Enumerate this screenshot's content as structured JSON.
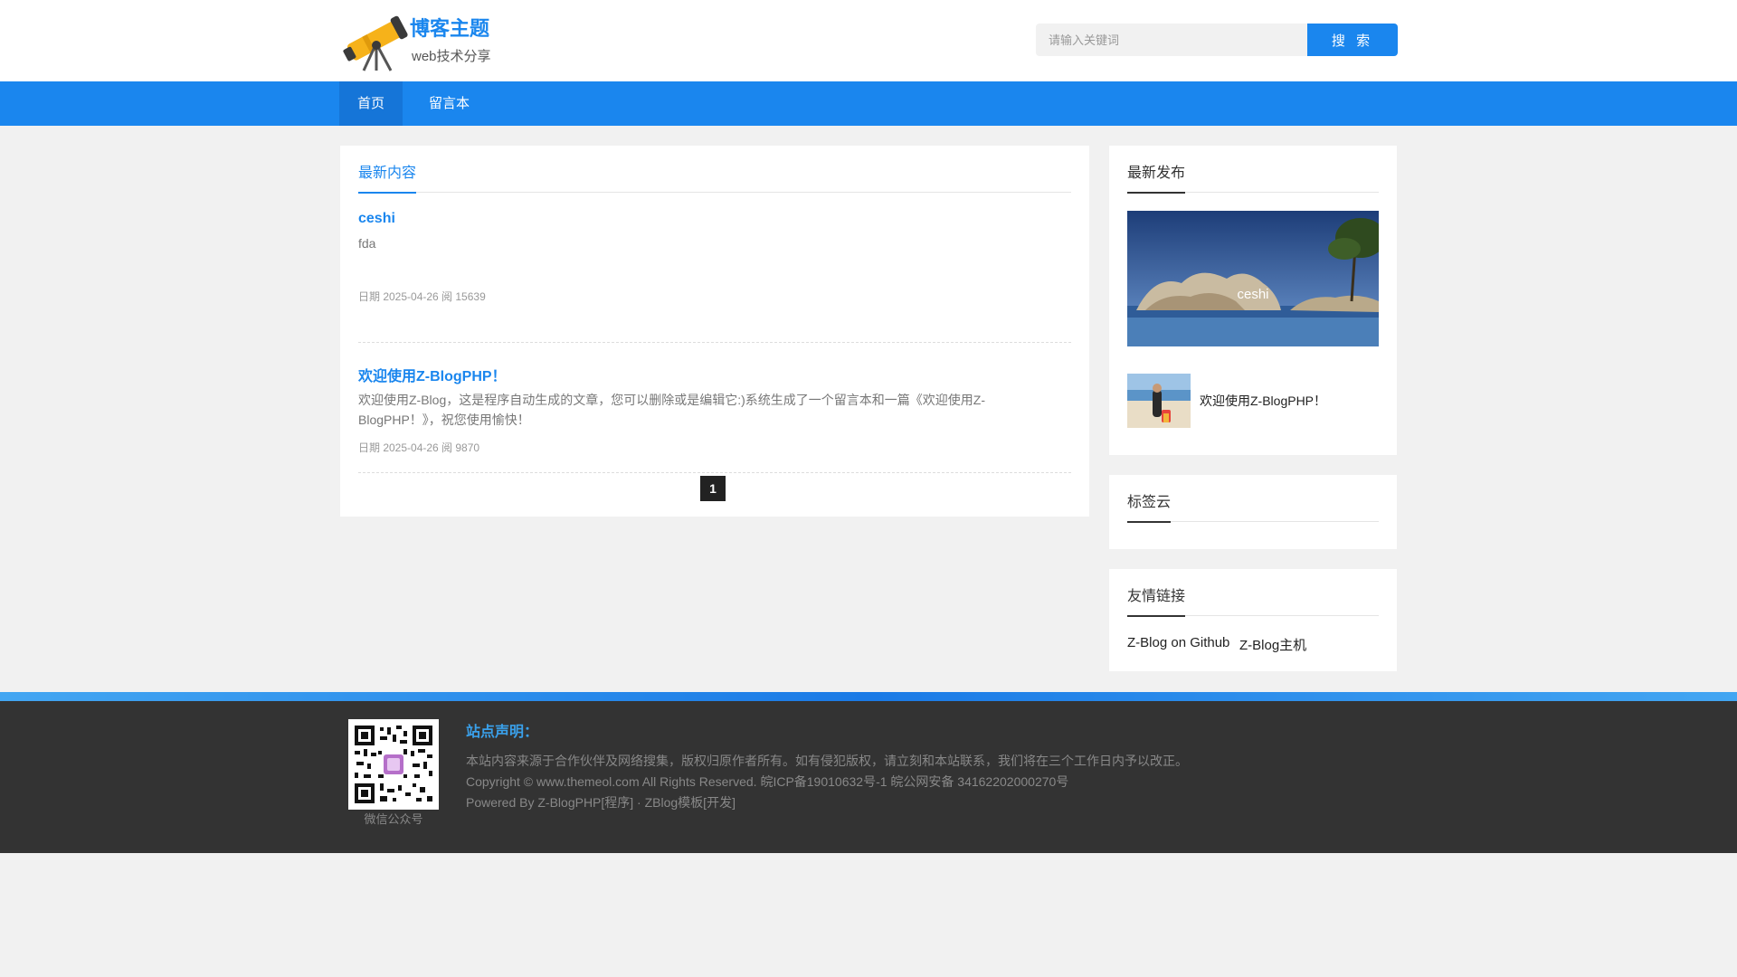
{
  "brand": {
    "title": "博客主题",
    "subtitle": "web技术分享"
  },
  "search": {
    "placeholder": "请输入关键词",
    "button_label": "搜 索"
  },
  "nav": {
    "items": [
      {
        "label": "首页",
        "active": true
      },
      {
        "label": "留言本",
        "active": false
      }
    ]
  },
  "main": {
    "section_title": "最新内容",
    "posts": [
      {
        "title": "ceshi",
        "excerpt": "fda",
        "meta": "日期 2025-04-26  阅 15639"
      },
      {
        "title": "欢迎使用Z-BlogPHP！",
        "excerpt": "欢迎使用Z-Blog，这是程序自动生成的文章，您可以删除或是编辑它:)系统生成了一个留言本和一篇《欢迎使用Z-BlogPHP！》，祝您使用愉快！",
        "meta": "日期 2025-04-26  阅 9870"
      }
    ],
    "pagination": {
      "current_page": "1"
    }
  },
  "sidebar": {
    "latest": {
      "title": "最新发布",
      "featured_caption": "ceshi",
      "items": [
        {
          "title": "欢迎使用Z-BlogPHP！"
        }
      ]
    },
    "tags": {
      "title": "标签云"
    },
    "links": {
      "title": "友情链接",
      "items": [
        {
          "label": "Z-Blog on Github"
        },
        {
          "label": "Z-Blog主机"
        }
      ]
    }
  },
  "footer": {
    "qr_label": "微信公众号",
    "notice_title": "站点声明：",
    "notice_text": "本站内容来源于合作伙伴及网络搜集，版权归原作者所有。如有侵犯版权，请立刻和本站联系，我们将在三个工作日内予以改正。",
    "copyright": "Copyright © www.themeol.com All Rights Reserved. 皖ICP备19010632号-1 皖公网安备 34162202000270号",
    "powered": "Powered By Z-BlogPHP[程序] · ZBlog模板[开发]"
  },
  "colors": {
    "accent": "#1a86ee",
    "nav_active": "#1575d8",
    "footer_bg": "#333333",
    "page_bg": "#f1f1f1"
  },
  "icons": {
    "logo": "telescope-icon"
  }
}
